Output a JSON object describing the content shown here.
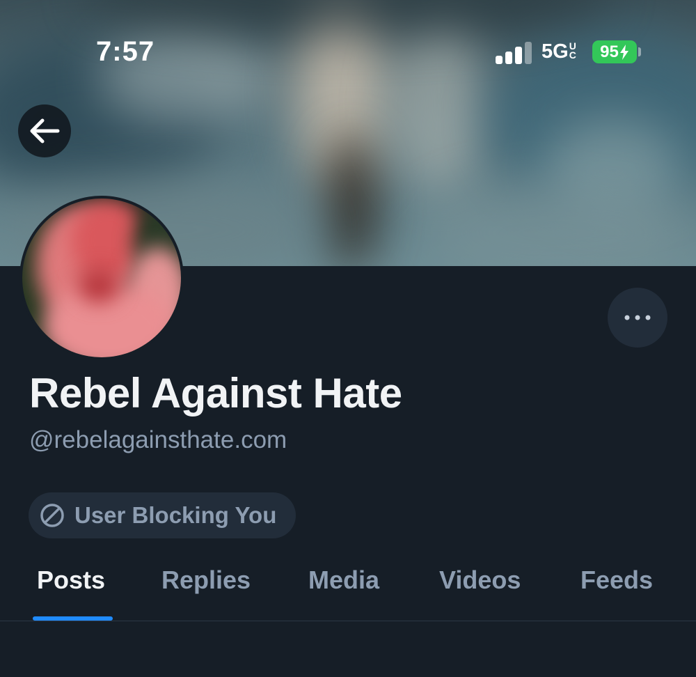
{
  "status_bar": {
    "time": "7:57",
    "network": "5G",
    "network_super": "U",
    "network_sub": "C",
    "battery": "95"
  },
  "profile": {
    "display_name": "Rebel Against Hate",
    "handle": "@rebelagainsthate.com",
    "blocking_label": "User Blocking You"
  },
  "tabs": [
    {
      "label": "Posts",
      "active": true
    },
    {
      "label": "Replies",
      "active": false
    },
    {
      "label": "Media",
      "active": false
    },
    {
      "label": "Videos",
      "active": false
    },
    {
      "label": "Feeds",
      "active": false
    }
  ],
  "icons": {
    "back": "arrow-left-icon",
    "more": "ellipsis-icon",
    "blocked": "ban-icon",
    "battery_charging": "bolt-icon"
  },
  "colors": {
    "background": "#161e27",
    "accent": "#208bfe",
    "muted_text": "#8d9db1",
    "battery": "#33c759"
  }
}
